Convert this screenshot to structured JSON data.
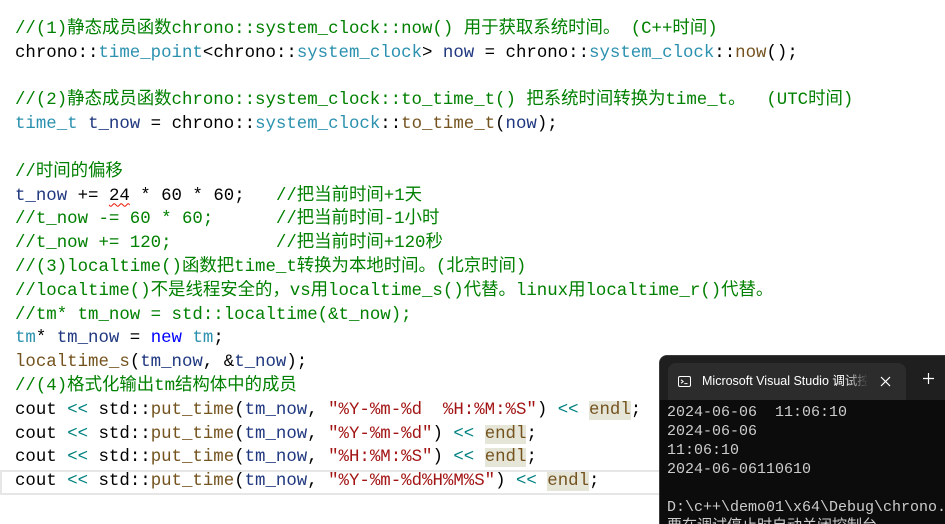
{
  "colors": {
    "comment": "#008000",
    "plain": "#000000",
    "namespace": "#000000",
    "type": "#2b91af",
    "function": "#74531f",
    "variable": "#1f377f",
    "number": "#000000",
    "string": "#a31515",
    "keyword": "#0000ff",
    "operator": "#008080",
    "reference_highlight": "#e6e6d8",
    "squiggle": "#e51400",
    "console_bg": "#0c0c0c",
    "console_tabbar": "#1f1f1f",
    "console_tab": "#2c2c2c",
    "console_text": "#cccccc"
  },
  "icons": {
    "tab": "terminal-icon",
    "close": "close-icon",
    "new_tab": "plus-icon"
  },
  "editor": {
    "lines": [
      [
        [
          "comment",
          "//(1)静态成员函数chrono::system_clock::now() 用于获取系统时间。 (C++时间)"
        ]
      ],
      [
        [
          "ns",
          "chrono"
        ],
        [
          "plain",
          "::"
        ],
        [
          "type",
          "time_point"
        ],
        [
          "plain",
          "<"
        ],
        [
          "ns",
          "chrono"
        ],
        [
          "plain",
          "::"
        ],
        [
          "type",
          "system_clock"
        ],
        [
          "plain",
          "> "
        ],
        [
          "var",
          "now"
        ],
        [
          "plain",
          " = "
        ],
        [
          "ns",
          "chrono"
        ],
        [
          "plain",
          "::"
        ],
        [
          "type",
          "system_clock"
        ],
        [
          "plain",
          "::"
        ],
        [
          "func",
          "now"
        ],
        [
          "plain",
          "();"
        ]
      ],
      [],
      [
        [
          "comment",
          "//(2)静态成员函数chrono::system_clock::to_time_t() 把系统时间转换为time_t。  (UTC时间)"
        ]
      ],
      [
        [
          "type",
          "time_t"
        ],
        [
          "plain",
          " "
        ],
        [
          "var",
          "t_now"
        ],
        [
          "plain",
          " = "
        ],
        [
          "ns",
          "chrono"
        ],
        [
          "plain",
          "::"
        ],
        [
          "type",
          "system_clock"
        ],
        [
          "plain",
          "::"
        ],
        [
          "func",
          "to_time_t"
        ],
        [
          "plain",
          "("
        ],
        [
          "var",
          "now"
        ],
        [
          "plain",
          ");"
        ]
      ],
      [],
      [
        [
          "comment",
          "//时间的偏移"
        ]
      ],
      [
        [
          "var",
          "t_now"
        ],
        [
          "plain",
          " += "
        ],
        [
          "num",
          "24",
          true
        ],
        [
          "plain",
          " * "
        ],
        [
          "num",
          "60"
        ],
        [
          "plain",
          " * "
        ],
        [
          "num",
          "60"
        ],
        [
          "plain",
          ";   "
        ],
        [
          "comment",
          "//把当前时间+1天"
        ]
      ],
      [
        [
          "comment",
          "//t_now -= 60 * 60;      //把当前时间-1小时"
        ]
      ],
      [
        [
          "comment",
          "//t_now += 120;          //把当前时间+120秒"
        ]
      ],
      [
        [
          "comment",
          "//(3)localtime()函数把time_t转换为本地时间。(北京时间)"
        ]
      ],
      [
        [
          "comment",
          "//localtime()不是线程安全的，vs用localtime_s()代替。linux用localtime_r()代替。"
        ]
      ],
      [
        [
          "comment",
          "//tm* tm_now = std::localtime(&t_now);"
        ]
      ],
      [
        [
          "type",
          "tm"
        ],
        [
          "plain",
          "* "
        ],
        [
          "var",
          "tm_now"
        ],
        [
          "plain",
          " = "
        ],
        [
          "kw",
          "new"
        ],
        [
          "plain",
          " "
        ],
        [
          "type",
          "tm"
        ],
        [
          "plain",
          ";"
        ]
      ],
      [
        [
          "func",
          "localtime_s"
        ],
        [
          "plain",
          "("
        ],
        [
          "var",
          "tm_now"
        ],
        [
          "plain",
          ", &"
        ],
        [
          "var",
          "t_now"
        ],
        [
          "plain",
          ");"
        ]
      ],
      [
        [
          "comment",
          "//(4)格式化输出tm结构体中的成员"
        ]
      ],
      [
        [
          "plain",
          "cout "
        ],
        [
          "op",
          "<<"
        ],
        [
          "plain",
          " "
        ],
        [
          "ns",
          "std"
        ],
        [
          "plain",
          "::"
        ],
        [
          "func",
          "put_time"
        ],
        [
          "plain",
          "("
        ],
        [
          "var",
          "tm_now"
        ],
        [
          "plain",
          ", "
        ],
        [
          "str",
          "\"%Y-%m-%d  %H:%M:%S\""
        ],
        [
          "plain",
          ") "
        ],
        [
          "op",
          "<<"
        ],
        [
          "plain",
          " "
        ],
        [
          "ref",
          "endl"
        ],
        [
          "plain",
          ";"
        ]
      ],
      [
        [
          "plain",
          "cout "
        ],
        [
          "op",
          "<<"
        ],
        [
          "plain",
          " "
        ],
        [
          "ns",
          "std"
        ],
        [
          "plain",
          "::"
        ],
        [
          "func",
          "put_time"
        ],
        [
          "plain",
          "("
        ],
        [
          "var",
          "tm_now"
        ],
        [
          "plain",
          ", "
        ],
        [
          "str",
          "\"%Y-%m-%d\""
        ],
        [
          "plain",
          ") "
        ],
        [
          "op",
          "<<"
        ],
        [
          "plain",
          " "
        ],
        [
          "ref",
          "endl"
        ],
        [
          "plain",
          ";"
        ]
      ],
      [
        [
          "plain",
          "cout "
        ],
        [
          "op",
          "<<"
        ],
        [
          "plain",
          " "
        ],
        [
          "ns",
          "std"
        ],
        [
          "plain",
          "::"
        ],
        [
          "func",
          "put_time"
        ],
        [
          "plain",
          "("
        ],
        [
          "var",
          "tm_now"
        ],
        [
          "plain",
          ", "
        ],
        [
          "str",
          "\"%H:%M:%S\""
        ],
        [
          "plain",
          ") "
        ],
        [
          "op",
          "<<"
        ],
        [
          "plain",
          " "
        ],
        [
          "ref",
          "endl"
        ],
        [
          "plain",
          ";"
        ]
      ],
      [
        [
          "plain",
          "cout "
        ],
        [
          "op",
          "<<"
        ],
        [
          "plain",
          " "
        ],
        [
          "ns",
          "std"
        ],
        [
          "plain",
          "::"
        ],
        [
          "func",
          "put_time"
        ],
        [
          "plain",
          "("
        ],
        [
          "var",
          "tm_now"
        ],
        [
          "plain",
          ", "
        ],
        [
          "str",
          "\"%Y-%m-%d%H%M%S\""
        ],
        [
          "plain",
          ") "
        ],
        [
          "op",
          "<<"
        ],
        [
          "plain",
          " "
        ],
        [
          "ref",
          "endl"
        ],
        [
          "plain",
          ";"
        ]
      ]
    ]
  },
  "console": {
    "tab_title": "Microsoft Visual Studio 调试控制台",
    "output_lines": [
      "2024-06-06  11:06:10",
      "2024-06-06",
      "11:06:10",
      "2024-06-06110610",
      "",
      "D:\\c++\\demo01\\x64\\Debug\\chrono.",
      "要在调试停止时自动关闭控制台"
    ]
  }
}
